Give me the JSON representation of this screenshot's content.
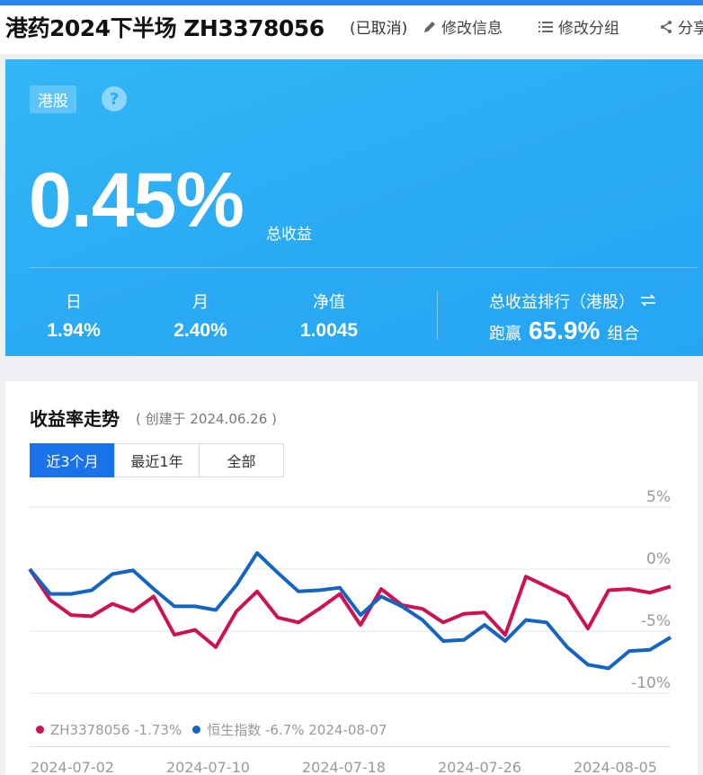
{
  "header": {
    "title": "港药2024下半场 ZH3378056",
    "status": "(已取消)",
    "edit_info": "修改信息",
    "edit_group": "修改分组",
    "share": "分享"
  },
  "summary": {
    "tag": "港股",
    "help": "?",
    "total_return": "0.45%",
    "total_return_label": "总收益",
    "stats": [
      {
        "label": "日",
        "value": "1.94%"
      },
      {
        "label": "月",
        "value": "2.40%"
      },
      {
        "label": "净值",
        "value": "1.0045"
      }
    ],
    "rank_label": "总收益排行（港股）",
    "rank_prefix": "跑赢",
    "rank_value": "65.9%",
    "rank_suffix": "组合"
  },
  "trend": {
    "title": "收益率走势",
    "created": "( 创建于 2024.06.26 )",
    "tabs": [
      {
        "label": "近3个月",
        "active": true
      },
      {
        "label": "最近1年",
        "active": false
      },
      {
        "label": "全部",
        "active": false
      }
    ],
    "legend": [
      {
        "label": "ZH3378056 -1.73%",
        "color": "#cc1155"
      },
      {
        "label": "恒生指数 -6.7% 2024-08-07",
        "color": "#1565c0"
      }
    ]
  },
  "colors": {
    "accent": "#1a73e8",
    "portfolio": "#cc1155",
    "index": "#1565c0"
  },
  "chart_data": {
    "type": "line",
    "ylim": [
      -10,
      5
    ],
    "yticks": [
      "5%",
      "0%",
      "-5%",
      "-10%"
    ],
    "yticks_values": [
      5,
      0,
      -5,
      -10
    ],
    "xticks": [
      "2024-07-02",
      "2024-07-10",
      "2024-07-18",
      "2024-07-26",
      "2024-08-05"
    ],
    "series": [
      {
        "name": "ZH3378056",
        "color": "#cc1155",
        "values": [
          0,
          -2.5,
          -3.7,
          -3.8,
          -2.8,
          -3.4,
          -2.2,
          -5.3,
          -4.9,
          -6.3,
          -3.4,
          -1.8,
          -3.9,
          -4.3,
          -3.2,
          -2.0,
          -4.5,
          -1.6,
          -2.9,
          -3.2,
          -4.3,
          -3.6,
          -3.5,
          -5.3,
          -0.6,
          -1.4,
          -2.2,
          -4.8,
          -1.7,
          -1.6,
          -1.9,
          -1.4
        ]
      },
      {
        "name": "恒生指数",
        "color": "#1565c0",
        "values": [
          0,
          -2.0,
          -2.0,
          -1.7,
          -0.4,
          -0.1,
          -1.6,
          -3.0,
          -3.0,
          -3.3,
          -1.3,
          1.3,
          -0.3,
          -1.8,
          -1.7,
          -1.5,
          -3.7,
          -2.2,
          -3.0,
          -4.1,
          -5.8,
          -5.7,
          -4.5,
          -5.8,
          -4.1,
          -4.3,
          -6.3,
          -7.7,
          -8.0,
          -6.6,
          -6.5,
          -5.5
        ]
      }
    ]
  }
}
